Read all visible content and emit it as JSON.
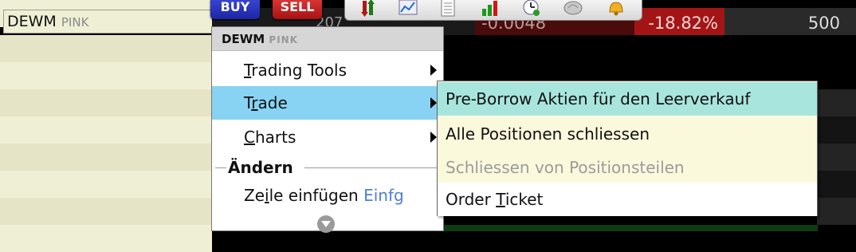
{
  "row": {
    "symbol": "DEWM",
    "exchange": "PINK",
    "partial_value": "207",
    "change": "-0.0048",
    "change_pct": "-18.82%",
    "volume": "500"
  },
  "toolbar": {
    "buy_label": "BUY",
    "sell_label": "SELL",
    "icons": [
      "order-arrows-icon",
      "chart-icon",
      "notepad-icon",
      "bar-chart-icon",
      "clock-icon",
      "snail-icon",
      "bell-icon"
    ]
  },
  "menu": {
    "header_symbol": "DEWM",
    "header_exchange": "PINK",
    "items": [
      {
        "pre": "",
        "ul": "T",
        "post": "rading Tools",
        "submenu": true
      },
      {
        "pre": "T",
        "ul": "r",
        "post": "ade",
        "submenu": true,
        "selected": true
      },
      {
        "pre": "",
        "ul": "C",
        "post": "harts",
        "submenu": true
      }
    ],
    "section_label": "Ändern",
    "insert_row": {
      "pre": "Ze",
      "ul": "i",
      "post": "le einfügen",
      "shortcut": "Einfg"
    }
  },
  "submenu": {
    "items": [
      {
        "label": "Pre-Borrow Aktien für den Leerverkauf",
        "state": "highlighted"
      },
      {
        "label": "Alle Positionen schliessen",
        "state": "normal"
      },
      {
        "label": "Schliessen von Positionsteilen",
        "state": "disabled"
      },
      {
        "pre": "Order ",
        "ul": "T",
        "post": "icket",
        "state": "normal"
      }
    ]
  },
  "colors": {
    "buy": "#2a35c4",
    "sell": "#c21f1f",
    "menu_selected": "#88d3f3",
    "submenu_highlight": "#a8e5dd",
    "shortcut": "#4f7fd6"
  }
}
